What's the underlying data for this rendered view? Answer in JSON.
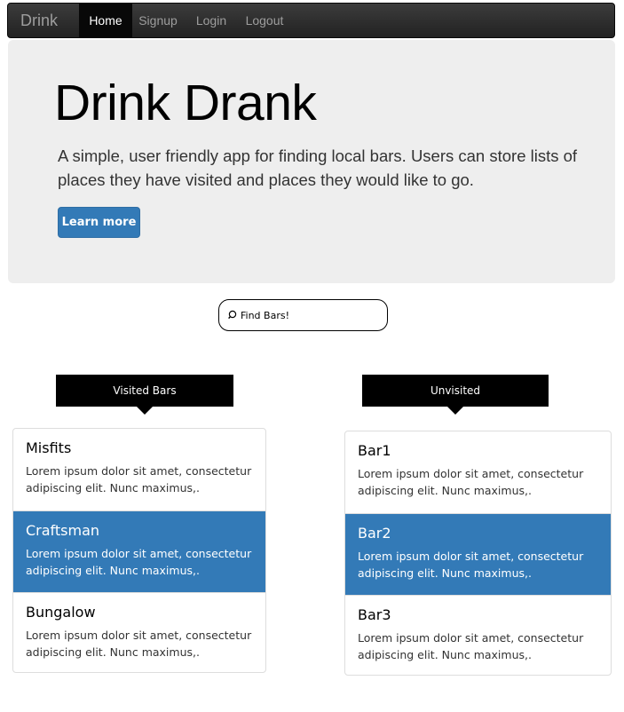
{
  "navbar": {
    "brand": "Drink",
    "items": [
      {
        "label": "Home",
        "active": true
      },
      {
        "label": "Signup",
        "active": false
      },
      {
        "label": "Login",
        "active": false
      },
      {
        "label": "Logout",
        "active": false
      }
    ]
  },
  "hero": {
    "title": "Drink Drank",
    "text": "A simple, user friendly app for finding local bars. Users can store lists of places they have visited and places they would like to go.",
    "button_label": "Learn more"
  },
  "search": {
    "placeholder": "Find Bars!"
  },
  "visited": {
    "header": "Visited Bars",
    "items": [
      {
        "title": "Misfits",
        "text": "Lorem ipsum dolor sit amet, consectetur adipiscing elit. Nunc maximus,.",
        "active": false
      },
      {
        "title": "Craftsman",
        "text": "Lorem ipsum dolor sit amet, consectetur adipiscing elit. Nunc maximus,.",
        "active": true
      },
      {
        "title": "Bungalow",
        "text": "Lorem ipsum dolor sit amet, consectetur adipiscing elit. Nunc maximus,.",
        "active": false
      }
    ]
  },
  "unvisited": {
    "header": "Unvisited",
    "items": [
      {
        "title": "Bar1",
        "text": "Lorem ipsum dolor sit amet, consectetur adipiscing elit. Nunc maximus,.",
        "active": false
      },
      {
        "title": "Bar2",
        "text": "Lorem ipsum dolor sit amet, consectetur adipiscing elit. Nunc maximus,.",
        "active": true
      },
      {
        "title": "Bar3",
        "text": "Lorem ipsum dolor sit amet, consectetur adipiscing elit. Nunc maximus,.",
        "active": false
      }
    ]
  },
  "colors": {
    "primary": "#337ab7",
    "navbar": "#222222",
    "jumbotron": "#eeeeee"
  },
  "icons": {
    "search": "search-icon"
  }
}
